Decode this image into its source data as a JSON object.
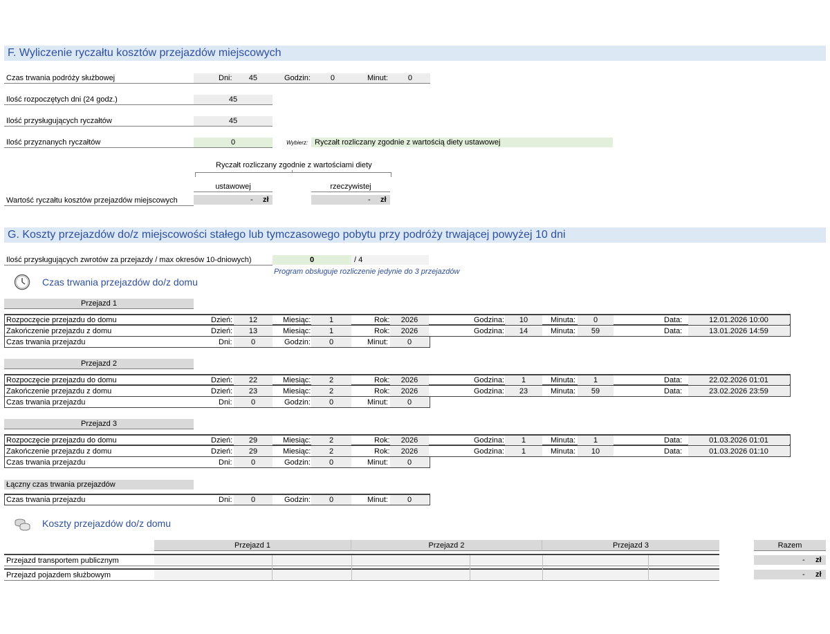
{
  "sectionF": {
    "title": "F. Wyliczenie ryczałtu kosztów przejazdów miejscowych",
    "duration_label": "Czas trwania podróży służbowej",
    "days_label": "Dni:",
    "days_value": "45",
    "hours_label": "Godzin:",
    "hours_value": "0",
    "minutes_label": "Minut:",
    "minutes_value": "0",
    "started_days_label": "Ilość rozpoczętych dni (24 godz.)",
    "started_days_value": "45",
    "due_lumps_label": "Ilość przysługujących ryczałtów",
    "due_lumps_value": "45",
    "granted_lumps_label": "Ilość przyznanych ryczałtów",
    "granted_lumps_value": "0",
    "choose_label": "Wybierz:",
    "choose_value": "Ryczałt rozliczany zgodnie z wartością diety ustawowej",
    "group_header": "Ryczałt rozliczany zgodnie z wartościami diety",
    "col_statutory": "ustawowej",
    "col_actual": "rzeczywistej",
    "value_label": "Wartość ryczałtu kosztów przejazdów miejscowych",
    "value_statutory": "-",
    "value_actual": "-",
    "currency": "zł"
  },
  "sectionG": {
    "title": "G. Koszty przejazdów do/z miejscowości stałego lub tymczasowego pobytu przy podróży trwającej powyżej 10 dni",
    "refunds_label": "Ilość przysługujących zwrotów za przejazdy / max okresów 10-dniowych)",
    "refunds_value": "0",
    "refunds_max": "/  4",
    "note": "Program obsługuje rozliczenie jedynie do 3 przejazdów",
    "durations_title": "Czas trwania przejazdów do/z domu",
    "labels": {
      "start": "Rozpoczęcie przejazdu do domu",
      "end": "Zakończenie przejazdu z domu",
      "duration": "Czas trwania przejazdu",
      "day": "Dzień:",
      "month": "Miesiąc:",
      "year": "Rok:",
      "hour": "Godzina:",
      "minute": "Minuta:",
      "date": "Data:",
      "days": "Dni:",
      "hours": "Godzin:",
      "minutes": "Minut:"
    },
    "trips": [
      {
        "name": "Przejazd 1",
        "start": {
          "day": "12",
          "month": "1",
          "year": "2026",
          "hour": "10",
          "minute": "0",
          "date": "12.01.2026 10:00"
        },
        "end": {
          "day": "13",
          "month": "1",
          "year": "2026",
          "hour": "14",
          "minute": "59",
          "date": "13.01.2026 14:59"
        },
        "duration": {
          "days": "0",
          "hours": "0",
          "minutes": "0"
        }
      },
      {
        "name": "Przejazd 2",
        "start": {
          "day": "22",
          "month": "2",
          "year": "2026",
          "hour": "1",
          "minute": "1",
          "date": "22.02.2026 01:01"
        },
        "end": {
          "day": "23",
          "month": "2",
          "year": "2026",
          "hour": "23",
          "minute": "59",
          "date": "23.02.2026 23:59"
        },
        "duration": {
          "days": "0",
          "hours": "0",
          "minutes": "0"
        }
      },
      {
        "name": "Przejazd 3",
        "start": {
          "day": "29",
          "month": "2",
          "year": "2026",
          "hour": "1",
          "minute": "1",
          "date": "01.03.2026 01:01"
        },
        "end": {
          "day": "29",
          "month": "2",
          "year": "2026",
          "hour": "1",
          "minute": "10",
          "date": "01.03.2026 01:10"
        },
        "duration": {
          "days": "0",
          "hours": "0",
          "minutes": "0"
        }
      }
    ],
    "total_header": "Łączny czas trwania przejazdów",
    "total": {
      "label": "Czas trwania przejazdu",
      "days": "0",
      "hours": "0",
      "minutes": "0"
    },
    "costs_title": "Koszty przejazdów do/z domu",
    "cost_cols": [
      "Przejazd 1",
      "Przejazd 2",
      "Przejazd 3"
    ],
    "sum_header": "Razem",
    "cost_rows": [
      {
        "label": "Przejazd transportem publicznym",
        "sum": "-",
        "currency": "zł"
      },
      {
        "label": "Przejazd pojazdem służbowym",
        "sum": "-",
        "currency": "zł"
      }
    ]
  }
}
